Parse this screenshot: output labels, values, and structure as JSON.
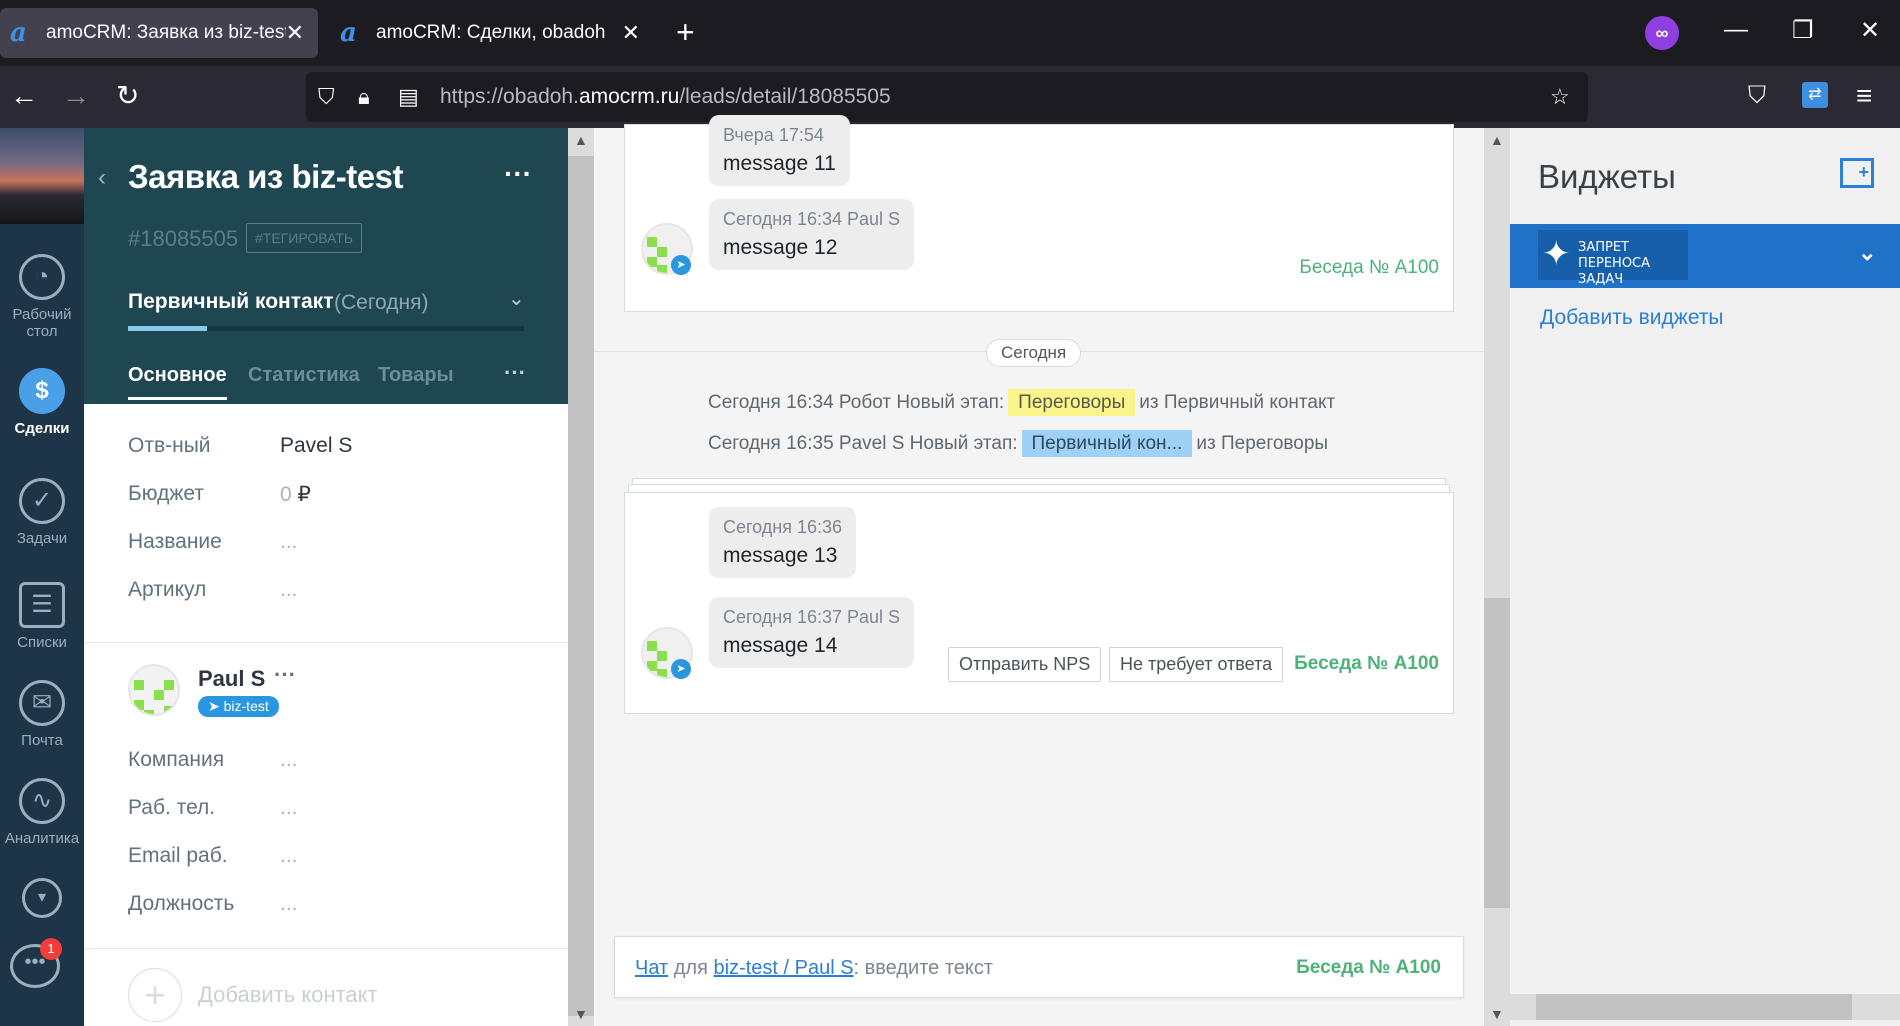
{
  "browser": {
    "tabs": [
      {
        "title": "amoCRM: Заявка из biz-test, ob",
        "active": true
      },
      {
        "title": "amoCRM: Сделки, obadoh",
        "active": false
      }
    ],
    "url_prefix": "https://obadoh.",
    "url_domain": "amocrm.ru",
    "url_path": "/leads/detail/18085505"
  },
  "leftnav": {
    "items": [
      {
        "label": "Рабочий стол",
        "icon": "dashboard-icon",
        "glyph": "◔"
      },
      {
        "label": "Сделки",
        "icon": "deals-icon",
        "glyph": "$",
        "active": true
      },
      {
        "label": "Задачи",
        "icon": "tasks-icon",
        "glyph": "✓"
      },
      {
        "label": "Списки",
        "icon": "lists-icon",
        "glyph": "☰"
      },
      {
        "label": "Почта",
        "icon": "mail-icon",
        "glyph": "✉"
      },
      {
        "label": "Аналитика",
        "icon": "analytics-icon",
        "glyph": "∿"
      }
    ],
    "chat_badge": "1"
  },
  "lead": {
    "title": "Заявка из biz-test",
    "id": "#18085505",
    "tag_button": "#ТЕГИРОВАТЬ",
    "stage": "Первичный контакт",
    "stage_date": "(Сегодня)",
    "stage_progress": 0.2,
    "tabs": [
      "Основное",
      "Статистика",
      "Товары"
    ],
    "fields": [
      {
        "label": "Отв-ный",
        "value": "Pavel S",
        "muted": false
      },
      {
        "label": "Бюджет",
        "value": "0",
        "suffix": "₽",
        "muted": true
      },
      {
        "label": "Название",
        "value": "...",
        "muted": true
      },
      {
        "label": "Артикул",
        "value": "...",
        "muted": true
      }
    ],
    "contact": {
      "name": "Paul S",
      "source": "biz-test",
      "fields": [
        {
          "label": "Компания",
          "value": "..."
        },
        {
          "label": "Раб. тел.",
          "value": "..."
        },
        {
          "label": "Email раб.",
          "value": "..."
        },
        {
          "label": "Должность",
          "value": "..."
        }
      ]
    },
    "add_contact": "Добавить контакт"
  },
  "feed": {
    "block1": {
      "msg1_meta": "Вчера 17:54",
      "msg1_text": "message 11",
      "msg2_meta": "Сегодня 16:34 Paul S",
      "msg2_text": "message 12",
      "conv": "Беседа № А100"
    },
    "day_separator": "Сегодня",
    "events": [
      {
        "prefix": "Сегодня 16:34 Робот Новый этап:",
        "stage": "Переговоры",
        "suffix": "из Первичный контакт"
      },
      {
        "prefix": "Сегодня 16:35 Pavel S Новый этап:",
        "stage": "Первичный кон...",
        "suffix": "из Переговоры"
      }
    ],
    "block2": {
      "msg1_meta": "Сегодня 16:36",
      "msg1_text": "message 13",
      "msg2_meta": "Сегодня 16:37 Paul S",
      "msg2_text": "message 14",
      "btn_nps": "Отправить NPS",
      "btn_noreply": "Не требует ответа",
      "conv": "Беседа № А100"
    },
    "chat_input": {
      "chat_link": "Чат",
      "for_word": "для",
      "target_link": "biz-test / Paul S",
      "placeholder": ": введите текст",
      "conv": "Беседа № А100"
    }
  },
  "widgets": {
    "title": "Виджеты",
    "widget_label_line1": "Запрет переноса",
    "widget_label_line2": "задач",
    "add_link": "Добавить виджеты"
  }
}
